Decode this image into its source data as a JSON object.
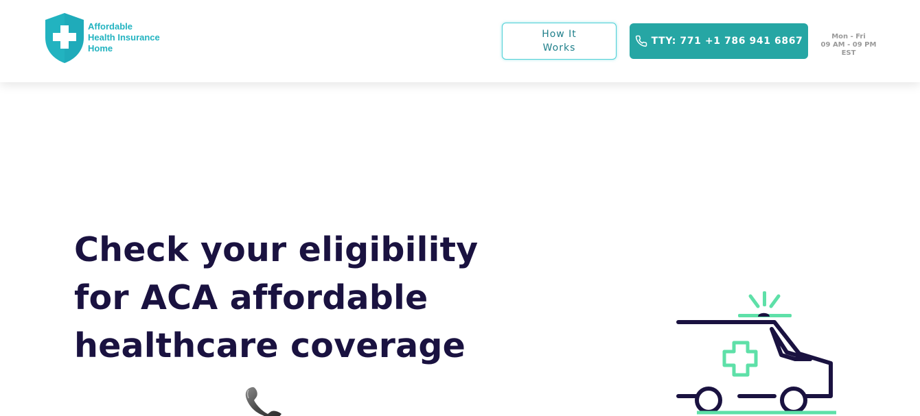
{
  "header": {
    "logo": {
      "line1": "Affordable",
      "line2": "Health Insurance",
      "line3": "Home",
      "icon": "shield-cross-icon"
    },
    "how_it_works_label": "How It Works",
    "tty_label": "TTY: 771 +1 786 941 6867",
    "hours": {
      "days": "Mon - Fri",
      "time": "09 AM - 09 PM EST"
    }
  },
  "hero": {
    "title_line1": "Check your eligibility",
    "title_line2": "for ACA affordable",
    "title_line3": "healthcare coverage"
  },
  "icons": {
    "phone": "phone-icon",
    "telephone_handset": "telephone-handset-icon",
    "ambulance": "ambulance-icon"
  },
  "colors": {
    "brand_teal": "#26a6a4",
    "logo_cyan": "#22b3c0",
    "heading_navy": "#1a1240",
    "accent_mint": "#5ee0a8"
  }
}
